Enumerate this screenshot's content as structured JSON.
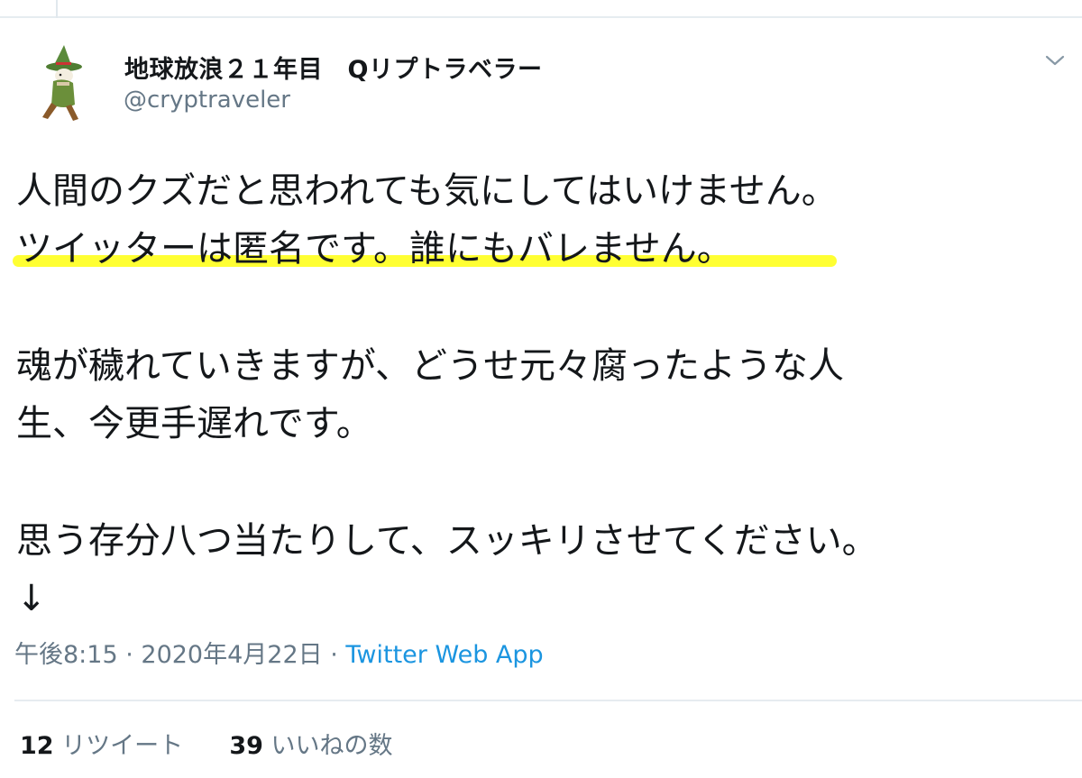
{
  "author": {
    "display_name": "地球放浪２１年目　Qリプトラベラー",
    "handle": "@cryptraveler",
    "avatar_icon": "snufkin-avatar-icon"
  },
  "tweet": {
    "lines": [
      "人間のクズだと思われても気にしてはいけません。",
      "ツイッターは匿名です。誰にもバレません。",
      "",
      "魂が穢れていきますが、どうせ元々腐ったような人",
      "生、今更手遅れです。",
      "",
      "思う存分八つ当たりして、スッキリさせてください。",
      "↓"
    ],
    "highlight_color": "#ffff33"
  },
  "meta": {
    "time": "午後8:15",
    "sep1": " · ",
    "date": "2020年4月22日",
    "sep2": " · ",
    "source": "Twitter Web App"
  },
  "stats": {
    "retweets_count": "12",
    "retweets_label": "リツイート",
    "likes_count": "39",
    "likes_label": "いいねの数"
  },
  "colors": {
    "text": "#14171a",
    "secondary": "#657786",
    "link": "#1b95e0",
    "border": "#e6ecf0"
  }
}
